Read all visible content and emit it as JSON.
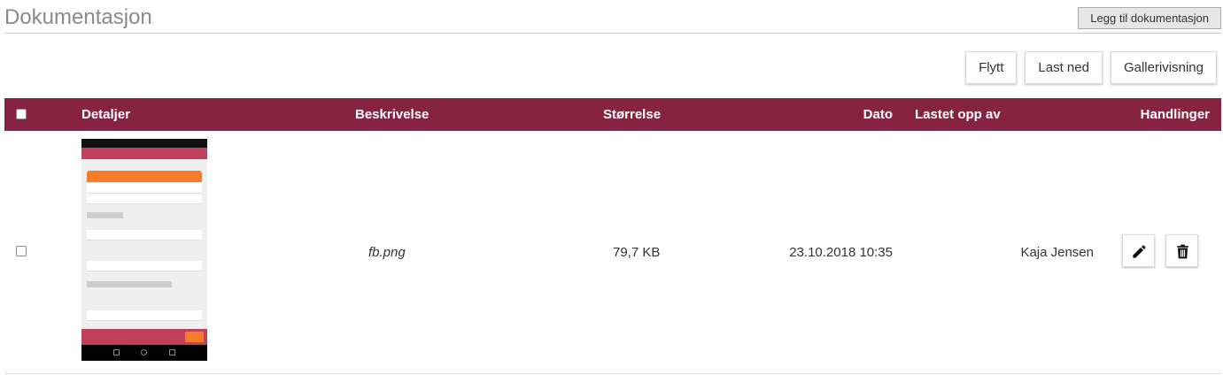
{
  "page": {
    "title": "Dokumentasjon",
    "add_button": "Legg til dokumentasjon"
  },
  "toolbar": {
    "move": "Flytt",
    "download": "Last ned",
    "gallery": "Gallerivisning"
  },
  "table": {
    "headers": {
      "details": "Detaljer",
      "description": "Beskrivelse",
      "size": "Størrelse",
      "date": "Dato",
      "uploaded_by": "Lastet opp av",
      "actions": "Handlinger"
    },
    "rows": [
      {
        "description": "fb.png",
        "size": "79,7 KB",
        "date": "23.10.2018 10:35",
        "uploaded_by": "Kaja Jensen",
        "actions": [
          "pencil-icon",
          "trash-icon"
        ]
      }
    ]
  },
  "colors": {
    "header_bg": "#862342",
    "title_text": "#8a8a8a"
  }
}
